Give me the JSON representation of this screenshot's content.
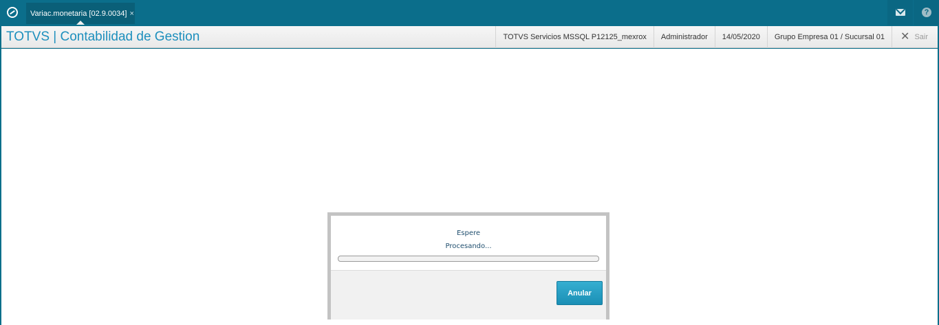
{
  "topbar": {
    "logo_icon": "totvs-logo-icon",
    "tab": {
      "label": "Variac.monetaria [02.9.0034]",
      "close": "×"
    },
    "icons": [
      "mail-icon",
      "help-icon"
    ],
    "help_glyph": "?"
  },
  "header": {
    "title": "TOTVS | Contabilidad de Gestion",
    "environment": "TOTVS Servicios MSSQL P12125_mexrox",
    "user": "Administrador",
    "date": "14/05/2020",
    "company": "Grupo Empresa 01 / Sucursal 01",
    "exit_label": "Sair"
  },
  "dialog": {
    "title": "Espere",
    "message": "Procesando...",
    "progress": 0,
    "cancel_label": "Anular"
  },
  "colors": {
    "topbar": "#0b6e8b",
    "accent": "#1d8fbd",
    "button": "#1a8fb5"
  }
}
